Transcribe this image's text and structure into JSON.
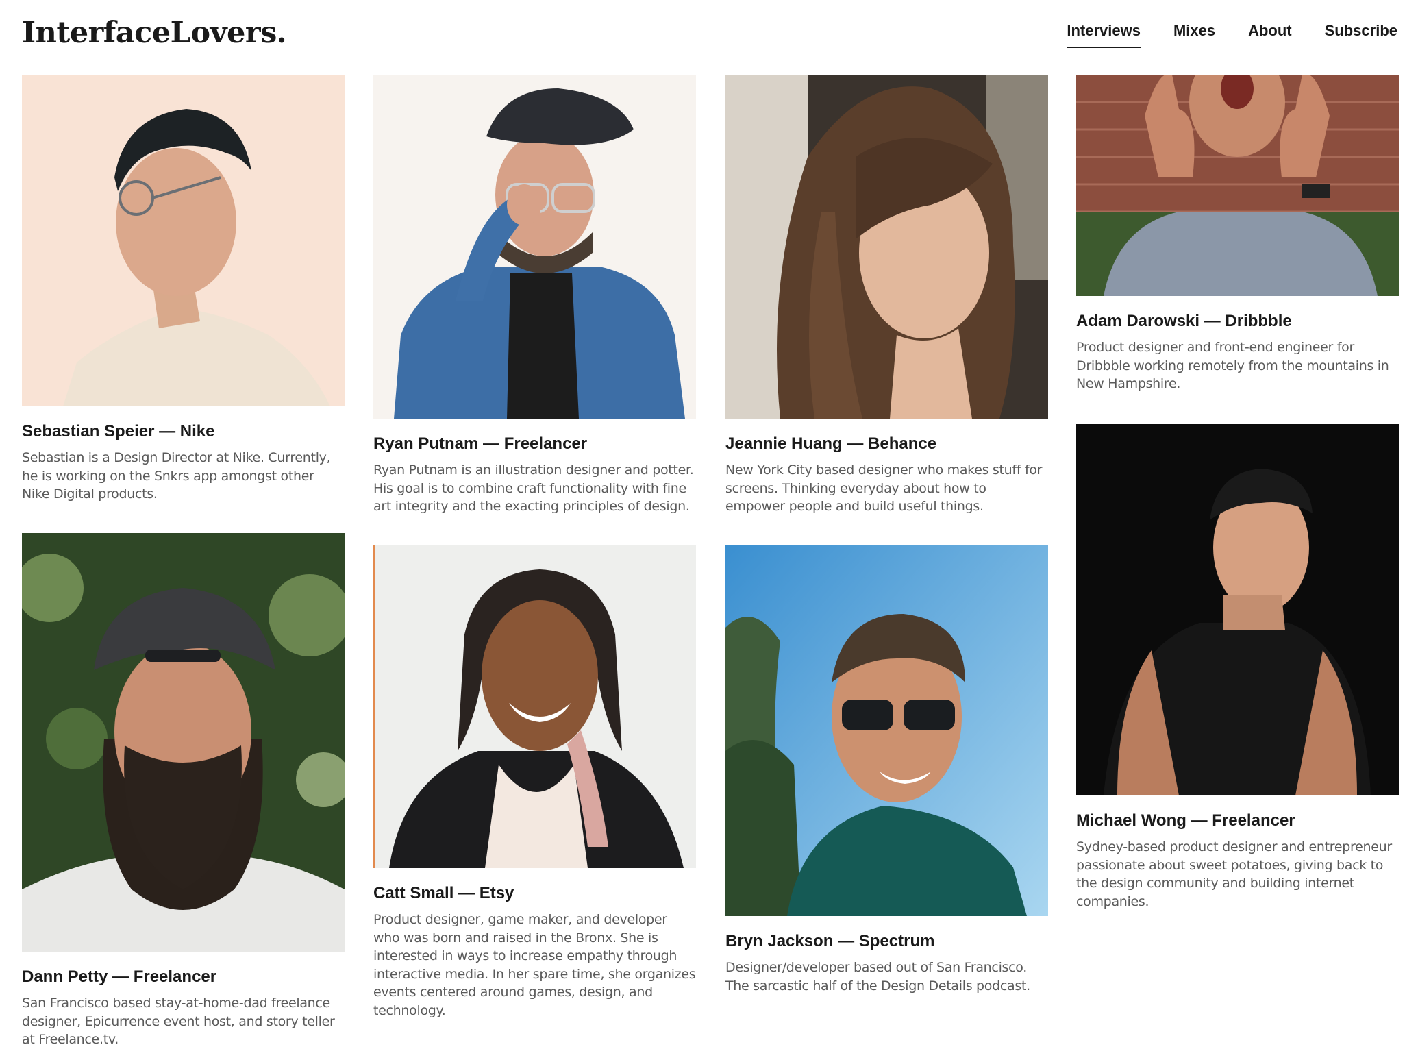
{
  "site": {
    "logo": "InterfaceLovers."
  },
  "nav": {
    "items": [
      {
        "label": "Interviews",
        "active": true
      },
      {
        "label": "Mixes",
        "active": false
      },
      {
        "label": "About",
        "active": false
      },
      {
        "label": "Subscribe",
        "active": false
      }
    ]
  },
  "interviews": [
    {
      "title": "Sebastian Speier — Nike",
      "description": "Sebastian is a Design Director at Nike. Currently, he is working on the Snkrs app amongst other Nike Digital products."
    },
    {
      "title": "Ryan Putnam — Freelancer",
      "description": "Ryan Putnam is an illustration designer and potter. His goal is to combine craft functionality with fine art integrity and the exacting principles of design."
    },
    {
      "title": "Jeannie Huang — Behance",
      "description": "New York City based designer who makes stuff for screens. Thinking everyday about how to empower people and build useful things."
    },
    {
      "title": "Adam Darowski — Dribbble",
      "description": "Product designer and front-end engineer for Dribbble working remotely from the mountains in New Hampshire."
    },
    {
      "title": "Dann Petty — Freelancer",
      "description": "San Francisco based stay-at-home-dad freelance designer, Epicurrence event host, and story teller at Freelance.tv."
    },
    {
      "title": "Catt Small — Etsy",
      "description": "Product designer, game maker, and developer who was born and raised in the Bronx. She is interested in ways to increase empathy through interactive media. In her spare time, she organizes events centered around games, design, and technology."
    },
    {
      "title": "Bryn Jackson — Spectrum",
      "description": "Designer/developer based out of San Francisco. The sarcastic half of the Design Details podcast."
    },
    {
      "title": "Michael Wong — Freelancer",
      "description": "Sydney-based product designer and entrepreneur passionate about sweet potatoes, giving back to the design community and building internet companies."
    }
  ],
  "colors": {
    "text": "#1a1a1a",
    "muted": "#5a5a5a",
    "background": "#ffffff"
  }
}
